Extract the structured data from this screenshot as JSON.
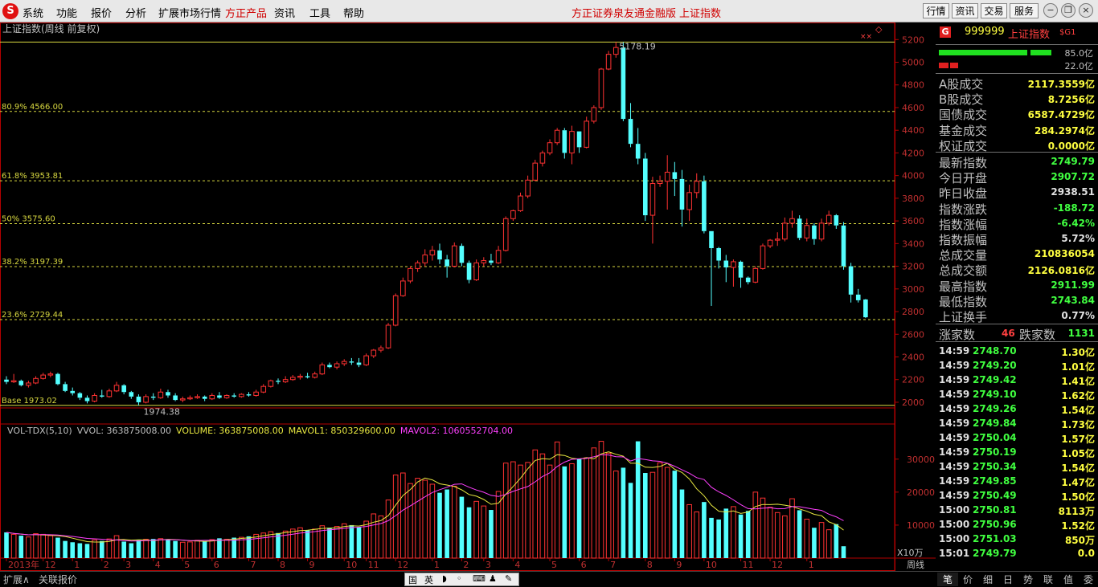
{
  "menu": {
    "items": [
      "系统",
      "功能",
      "报价",
      "分析",
      "扩展市场行情",
      "方正产品",
      "资讯",
      "工具",
      "帮助"
    ],
    "promo": [
      "方正证券泉友通金融版",
      "上证指数"
    ],
    "right_buttons": [
      "行情",
      "资讯",
      "交易",
      "服务"
    ]
  },
  "chart": {
    "title": "上证指数(周线 前复权)",
    "fib_levels": [
      {
        "label": "80.9% 4566.00",
        "value": 4566.0
      },
      {
        "label": "61.8% 3953.81",
        "value": 3953.81
      },
      {
        "label": "50% 3575.60",
        "value": 3575.6
      },
      {
        "label": "38.2% 3197.39",
        "value": 3197.39
      },
      {
        "label": "23.6% 2729.44",
        "value": 2729.44
      }
    ],
    "base_label": "Base 1973.02",
    "high_label": "5178.19",
    "low_label": "1974.38",
    "price_ticks": [
      "5200",
      "5000",
      "4800",
      "4600",
      "4400",
      "4200",
      "4000",
      "3800",
      "3600",
      "3400",
      "3200",
      "3000",
      "2800",
      "2600",
      "2400",
      "2200",
      "2000"
    ],
    "volume_header": {
      "a": "VOL-TDX(5,10)",
      "b": "VVOL: 363875008.00",
      "c": "VOLUME: 363875008.00",
      "d": "MAVOL1: 850329600.00",
      "e": "MAVOL2: 1060552704.00"
    },
    "vol_ticks": [
      "30000",
      "20000",
      "10000"
    ],
    "vol_unit": "X10万",
    "x_labels": [
      {
        "i": 0,
        "t": "2013年"
      },
      {
        "i": 5,
        "t": "12"
      },
      {
        "i": 9,
        "t": "1"
      },
      {
        "i": 13,
        "t": "2"
      },
      {
        "i": 16,
        "t": "3"
      },
      {
        "i": 20,
        "t": "4"
      },
      {
        "i": 24,
        "t": "5"
      },
      {
        "i": 28,
        "t": "6"
      },
      {
        "i": 33,
        "t": "7"
      },
      {
        "i": 37,
        "t": "8"
      },
      {
        "i": 41,
        "t": "9"
      },
      {
        "i": 46,
        "t": "10"
      },
      {
        "i": 49,
        "t": "11"
      },
      {
        "i": 53,
        "t": "12"
      },
      {
        "i": 58,
        "t": "1"
      },
      {
        "i": 62,
        "t": "2"
      },
      {
        "i": 65,
        "t": "3"
      },
      {
        "i": 69,
        "t": "4"
      },
      {
        "i": 74,
        "t": "5"
      },
      {
        "i": 78,
        "t": "6"
      },
      {
        "i": 82,
        "t": "7"
      },
      {
        "i": 87,
        "t": "8"
      },
      {
        "i": 91,
        "t": "9"
      },
      {
        "i": 95,
        "t": "10"
      },
      {
        "i": 100,
        "t": "11"
      },
      {
        "i": 104,
        "t": "12"
      },
      {
        "i": 109,
        "t": "1"
      }
    ],
    "period_label": "周线",
    "colors": {
      "up": "#ff3232",
      "down": "#54ffff",
      "fib": "#d8d840",
      "ma1": "#e8e840",
      "ma2": "#ff40ff"
    }
  },
  "chart_data": {
    "type": "candlestick",
    "title": "上证指数(周线 前复权)",
    "ylim": [
      1950,
      5280
    ],
    "candles": [
      [
        2200,
        2230,
        2180,
        2160
      ],
      [
        2180,
        2250,
        2190,
        2170
      ],
      [
        2190,
        2200,
        2150,
        2140
      ],
      [
        2150,
        2190,
        2170,
        2130
      ],
      [
        2170,
        2230,
        2210,
        2160
      ],
      [
        2210,
        2260,
        2240,
        2200
      ],
      [
        2240,
        2270,
        2250,
        2220
      ],
      [
        2250,
        2260,
        2160,
        2150
      ],
      [
        2160,
        2180,
        2100,
        2090
      ],
      [
        2100,
        2130,
        2080,
        2060
      ],
      [
        2080,
        2090,
        2040,
        2020
      ],
      [
        2040,
        2060,
        2010,
        1990
      ],
      [
        2010,
        2080,
        2060,
        2000
      ],
      [
        2060,
        2110,
        2050,
        2040
      ],
      [
        2050,
        2120,
        2100,
        2040
      ],
      [
        2100,
        2180,
        2150,
        2090
      ],
      [
        2150,
        2160,
        2090,
        2070
      ],
      [
        2090,
        2100,
        2050,
        2030
      ],
      [
        2050,
        2070,
        2000,
        1974
      ],
      [
        2000,
        2070,
        2050,
        1990
      ],
      [
        2050,
        2080,
        2040,
        2020
      ],
      [
        2040,
        2120,
        2090,
        2030
      ],
      [
        2090,
        2110,
        2060,
        2040
      ],
      [
        2060,
        2080,
        2020,
        2010
      ],
      [
        2020,
        2050,
        2030,
        2000
      ],
      [
        2030,
        2060,
        2040,
        2020
      ],
      [
        2040,
        2070,
        2050,
        2030
      ],
      [
        2050,
        2060,
        2030,
        2010
      ],
      [
        2030,
        2080,
        2060,
        2020
      ],
      [
        2060,
        2090,
        2040,
        2030
      ],
      [
        2040,
        2070,
        2060,
        2030
      ],
      [
        2060,
        2080,
        2050,
        2040
      ],
      [
        2050,
        2080,
        2070,
        2040
      ],
      [
        2070,
        2090,
        2060,
        2050
      ],
      [
        2060,
        2110,
        2090,
        2050
      ],
      [
        2090,
        2160,
        2140,
        2080
      ],
      [
        2140,
        2200,
        2190,
        2130
      ],
      [
        2190,
        2210,
        2180,
        2160
      ],
      [
        2180,
        2230,
        2200,
        2170
      ],
      [
        2200,
        2240,
        2220,
        2190
      ],
      [
        2220,
        2250,
        2230,
        2200
      ],
      [
        2230,
        2260,
        2220,
        2210
      ],
      [
        2220,
        2270,
        2250,
        2210
      ],
      [
        2250,
        2350,
        2330,
        2240
      ],
      [
        2330,
        2350,
        2310,
        2300
      ],
      [
        2310,
        2360,
        2340,
        2290
      ],
      [
        2340,
        2380,
        2360,
        2320
      ],
      [
        2360,
        2390,
        2350,
        2330
      ],
      [
        2350,
        2390,
        2330,
        2310
      ],
      [
        2330,
        2430,
        2410,
        2320
      ],
      [
        2410,
        2470,
        2460,
        2390
      ],
      [
        2460,
        2500,
        2480,
        2440
      ],
      [
        2480,
        2700,
        2680,
        2470
      ],
      [
        2680,
        2960,
        2940,
        2670
      ],
      [
        2940,
        3100,
        3070,
        2930
      ],
      [
        3070,
        3200,
        3180,
        3050
      ],
      [
        3180,
        3250,
        3230,
        3150
      ],
      [
        3230,
        3350,
        3300,
        3200
      ],
      [
        3300,
        3380,
        3340,
        3250
      ],
      [
        3340,
        3400,
        3260,
        3220
      ],
      [
        3260,
        3300,
        3200,
        3100
      ],
      [
        3200,
        3410,
        3380,
        3190
      ],
      [
        3380,
        3400,
        3230,
        3200
      ],
      [
        3230,
        3250,
        3080,
        3050
      ],
      [
        3080,
        3260,
        3230,
        3070
      ],
      [
        3230,
        3280,
        3250,
        3200
      ],
      [
        3250,
        3310,
        3230,
        3210
      ],
      [
        3230,
        3380,
        3340,
        3220
      ],
      [
        3340,
        3640,
        3620,
        3330
      ],
      [
        3620,
        3700,
        3690,
        3600
      ],
      [
        3690,
        3850,
        3820,
        3680
      ],
      [
        3820,
        4000,
        3960,
        3800
      ],
      [
        3960,
        4140,
        4110,
        3950
      ],
      [
        4110,
        4220,
        4200,
        4080
      ],
      [
        4200,
        4320,
        4290,
        4180
      ],
      [
        4290,
        4420,
        4400,
        4270
      ],
      [
        4400,
        4420,
        4200,
        4150
      ],
      [
        4200,
        4440,
        4390,
        4100
      ],
      [
        4390,
        4390,
        4250,
        4200
      ],
      [
        4250,
        4520,
        4480,
        4240
      ],
      [
        4480,
        4620,
        4600,
        4460
      ],
      [
        4600,
        4950,
        4940,
        4580
      ],
      [
        4940,
        5100,
        5070,
        4930
      ],
      [
        5070,
        5178,
        5130,
        5040
      ],
      [
        5130,
        5178,
        4500,
        4480
      ],
      [
        4500,
        4640,
        4280,
        4250
      ],
      [
        4280,
        4420,
        4150,
        4100
      ],
      [
        4150,
        4200,
        3650,
        3600
      ],
      [
        3650,
        3990,
        3930,
        3400
      ],
      [
        3930,
        4000,
        3950,
        3900
      ],
      [
        3950,
        4180,
        4030,
        3700
      ],
      [
        4030,
        4120,
        3970,
        3820
      ],
      [
        3970,
        4050,
        3700,
        3550
      ],
      [
        3700,
        3920,
        3850,
        3600
      ],
      [
        3850,
        4020,
        3950,
        3800
      ],
      [
        3950,
        4000,
        3510,
        3490
      ],
      [
        3510,
        3510,
        3360,
        2850
      ],
      [
        3360,
        3370,
        3250,
        3180
      ],
      [
        3250,
        3300,
        3190,
        3060
      ],
      [
        3190,
        3260,
        3240,
        3020
      ],
      [
        3240,
        3250,
        3100,
        3010
      ],
      [
        3100,
        3110,
        3060,
        3040
      ],
      [
        3060,
        3200,
        3180,
        3050
      ],
      [
        3180,
        3400,
        3380,
        3170
      ],
      [
        3380,
        3440,
        3430,
        3360
      ],
      [
        3430,
        3500,
        3440,
        3380
      ],
      [
        3440,
        3630,
        3580,
        3420
      ],
      [
        3580,
        3690,
        3620,
        3540
      ],
      [
        3620,
        3650,
        3450,
        3430
      ],
      [
        3450,
        3620,
        3560,
        3420
      ],
      [
        3560,
        3580,
        3440,
        3390
      ],
      [
        3440,
        3620,
        3580,
        3420
      ],
      [
        3580,
        3690,
        3650,
        3560
      ],
      [
        3650,
        3660,
        3560,
        3530
      ],
      [
        3560,
        3590,
        3200,
        3170
      ],
      [
        3200,
        3230,
        2950,
        2880
      ],
      [
        2950,
        3000,
        2900,
        2880
      ],
      [
        2907,
        2911,
        2750,
        2743
      ]
    ],
    "volume": [
      7800,
      7200,
      6800,
      6400,
      7400,
      7200,
      6800,
      6200,
      5200,
      4800,
      4500,
      4300,
      5500,
      5200,
      5800,
      6800,
      5000,
      4500,
      5600,
      5700,
      5800,
      5900,
      5500,
      5200,
      4800,
      4900,
      5400,
      5100,
      5600,
      6000,
      5700,
      6200,
      6300,
      6600,
      7200,
      7600,
      8000,
      7600,
      8200,
      8800,
      9200,
      8400,
      8800,
      9800,
      9200,
      9600,
      10400,
      10000,
      9400,
      11200,
      13400,
      12800,
      17600,
      25200,
      25800,
      22600,
      24200,
      23600,
      22400,
      19800,
      20800,
      21800,
      18600,
      15400,
      17200,
      15800,
      14600,
      20200,
      28800,
      29200,
      28200,
      29000,
      32800,
      31600,
      28200,
      35200,
      27800,
      28600,
      30200,
      30400,
      33400,
      35400,
      31800,
      26400,
      27400,
      22800,
      35400,
      25800,
      26000,
      28900,
      27500,
      26500,
      20800,
      16200,
      14000,
      17000,
      12200,
      11700,
      15000,
      15600,
      13200,
      14300,
      20000,
      18200,
      15400,
      13800,
      12800,
      18000,
      14500,
      11800,
      9200,
      10800,
      8600,
      10300,
      3600
    ]
  },
  "panel": {
    "badge": "G",
    "code": "999999",
    "name": "上证指数",
    "sg": "$G1",
    "bar1_value": "85.0亿",
    "bar2_value": "22.0亿",
    "rows1": [
      {
        "label": "A股成交",
        "value": "2117.3559亿",
        "color": "#ffff40"
      },
      {
        "label": "B股成交",
        "value": "8.7256亿",
        "color": "#ffff40"
      },
      {
        "label": "国债成交",
        "value": "6587.4729亿",
        "color": "#ffff40"
      },
      {
        "label": "基金成交",
        "value": "284.2974亿",
        "color": "#ffff40"
      },
      {
        "label": "权证成交",
        "value": "0.0000亿",
        "color": "#ffff40"
      }
    ],
    "rows2": [
      {
        "label": "最新指数",
        "value": "2749.79",
        "color": "#40ff40"
      },
      {
        "label": "今日开盘",
        "value": "2907.72",
        "color": "#40ff40"
      },
      {
        "label": "昨日收盘",
        "value": "2938.51",
        "color": "#e0e0e0"
      },
      {
        "label": "指数涨跌",
        "value": "-188.72",
        "color": "#40ff40"
      },
      {
        "label": "指数涨幅",
        "value": "-6.42%",
        "color": "#40ff40"
      },
      {
        "label": "指数振幅",
        "value": "5.72%",
        "color": "#e0e0e0"
      },
      {
        "label": "总成交量",
        "value": "210836054",
        "color": "#ffff40"
      },
      {
        "label": "总成交额",
        "value": "2126.0816亿",
        "color": "#ffff40"
      },
      {
        "label": "最高指数",
        "value": "2911.99",
        "color": "#40ff40"
      },
      {
        "label": "最低指数",
        "value": "2743.84",
        "color": "#40ff40"
      },
      {
        "label": "上证换手",
        "value": "0.77%",
        "color": "#e0e0e0"
      }
    ],
    "up_label": "涨家数",
    "up_count": "46",
    "down_label": "跌家数",
    "down_count": "1131",
    "ticks": [
      {
        "time": "14:59",
        "price": "2748.70",
        "vol": "1.30亿"
      },
      {
        "time": "14:59",
        "price": "2749.20",
        "vol": "1.01亿"
      },
      {
        "time": "14:59",
        "price": "2749.42",
        "vol": "1.41亿"
      },
      {
        "time": "14:59",
        "price": "2749.10",
        "vol": "1.62亿"
      },
      {
        "time": "14:59",
        "price": "2749.26",
        "vol": "1.54亿"
      },
      {
        "time": "14:59",
        "price": "2749.84",
        "vol": "1.73亿"
      },
      {
        "time": "14:59",
        "price": "2750.04",
        "vol": "1.57亿"
      },
      {
        "time": "14:59",
        "price": "2750.19",
        "vol": "1.05亿"
      },
      {
        "time": "14:59",
        "price": "2750.34",
        "vol": "1.54亿"
      },
      {
        "time": "14:59",
        "price": "2749.85",
        "vol": "1.47亿"
      },
      {
        "time": "14:59",
        "price": "2750.49",
        "vol": "1.50亿"
      },
      {
        "time": "15:00",
        "price": "2750.81",
        "vol": "8113万"
      },
      {
        "time": "15:00",
        "price": "2750.96",
        "vol": "1.52亿"
      },
      {
        "time": "15:00",
        "price": "2751.03",
        "vol": "850万"
      },
      {
        "time": "15:01",
        "price": "2749.79",
        "vol": "0.0"
      }
    ]
  },
  "bottom": {
    "tabs": [
      "扩展∧",
      "关联报价"
    ],
    "ime": [
      "国",
      "英",
      "◗",
      "◦",
      "⌨",
      "♟",
      "✎"
    ],
    "right_tabs": [
      "笔",
      "价",
      "细",
      "日",
      "势",
      "联",
      "值",
      "委"
    ]
  }
}
